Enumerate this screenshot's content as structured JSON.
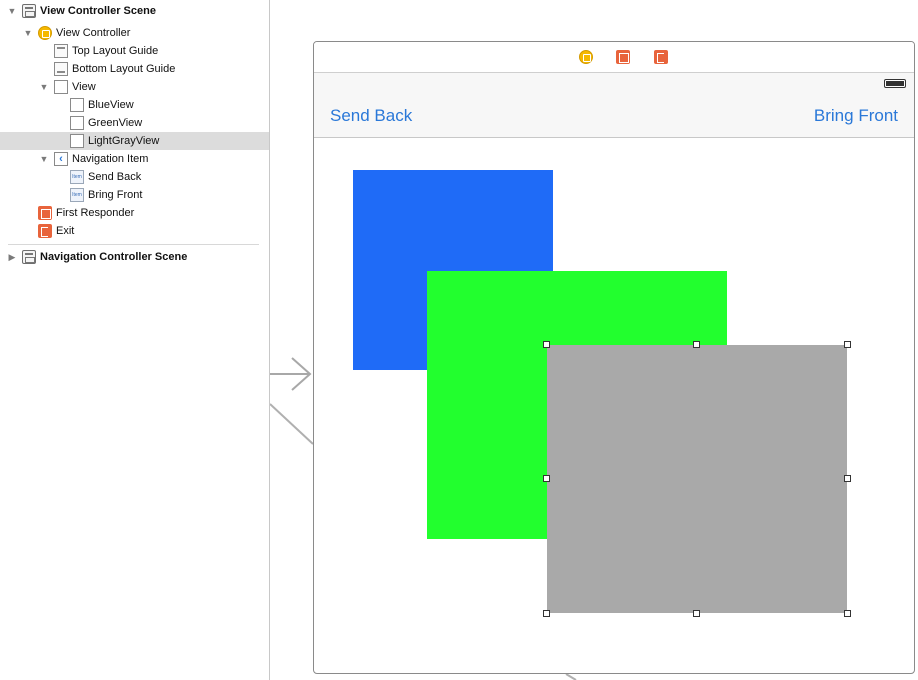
{
  "outline": {
    "rows": [
      {
        "label": "View Controller Scene",
        "bold": true,
        "disclosure": "open",
        "icon": "scene-icon",
        "selected": false
      },
      {
        "label": "View Controller",
        "bold": false,
        "disclosure": "open",
        "icon": "view-controller-icon",
        "selected": false
      },
      {
        "label": "Top Layout Guide",
        "bold": false,
        "disclosure": "none",
        "icon": "top-layout-guide-icon",
        "selected": false
      },
      {
        "label": "Bottom Layout Guide",
        "bold": false,
        "disclosure": "none",
        "icon": "bottom-layout-guide-icon",
        "selected": false
      },
      {
        "label": "View",
        "bold": false,
        "disclosure": "open",
        "icon": "view-icon",
        "selected": false
      },
      {
        "label": "BlueView",
        "bold": false,
        "disclosure": "none",
        "icon": "view-icon",
        "selected": false
      },
      {
        "label": "GreenView",
        "bold": false,
        "disclosure": "none",
        "icon": "view-icon",
        "selected": false
      },
      {
        "label": "LightGrayView",
        "bold": false,
        "disclosure": "none",
        "icon": "view-icon",
        "selected": true
      },
      {
        "label": "Navigation Item",
        "bold": false,
        "disclosure": "open",
        "icon": "navigation-item-icon",
        "selected": false
      },
      {
        "label": "Send Back",
        "bold": false,
        "disclosure": "none",
        "icon": "bar-button-item-icon",
        "selected": false
      },
      {
        "label": "Bring Front",
        "bold": false,
        "disclosure": "none",
        "icon": "bar-button-item-icon",
        "selected": false
      },
      {
        "label": "First Responder",
        "bold": false,
        "disclosure": "none",
        "icon": "first-responder-icon",
        "selected": false
      },
      {
        "label": "Exit",
        "bold": false,
        "disclosure": "none",
        "icon": "exit-icon",
        "selected": false
      },
      {
        "label": "Navigation Controller Scene",
        "bold": true,
        "disclosure": "closed",
        "icon": "scene-icon",
        "selected": false
      }
    ],
    "item_icon_text": "Item"
  },
  "canvas": {
    "dock_icons": [
      "view-controller-icon",
      "first-responder-icon",
      "exit-icon"
    ],
    "nav_bar": {
      "left_button": "Send Back",
      "right_button": "Bring Front"
    },
    "views": [
      {
        "name": "BlueView",
        "color": "#1f6bf7"
      },
      {
        "name": "GreenView",
        "color": "#22ff2e"
      },
      {
        "name": "LightGrayView",
        "color": "#a9a9a9",
        "selected": true
      }
    ],
    "accent_color": "#2a78d8"
  }
}
